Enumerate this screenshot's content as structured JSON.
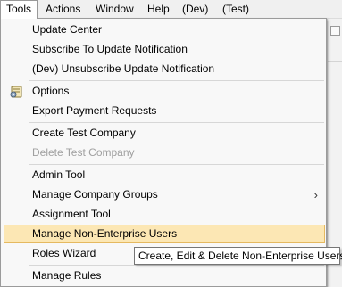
{
  "menubar": {
    "items": [
      {
        "label": "Tools"
      },
      {
        "label": "Actions"
      },
      {
        "label": "Window"
      },
      {
        "label": "Help"
      },
      {
        "label": "(Dev)"
      },
      {
        "label": "(Test)"
      }
    ]
  },
  "tools_menu": {
    "items": [
      {
        "label": "Update Center"
      },
      {
        "label": "Subscribe To Update Notification"
      },
      {
        "label": "(Dev) Unsubscribe Update Notification"
      },
      {
        "label": "Options",
        "icon": "options-icon"
      },
      {
        "label": "Export Payment Requests"
      },
      {
        "label": "Create Test Company"
      },
      {
        "label": "Delete Test Company",
        "disabled": true
      },
      {
        "label": "Admin Tool"
      },
      {
        "label": "Manage Company Groups",
        "submenu_indicator": "›"
      },
      {
        "label": "Assignment Tool"
      },
      {
        "label": "Manage Non-Enterprise Users",
        "highlighted": true
      },
      {
        "label": "Roles Wizard"
      },
      {
        "label": "Manage Rules"
      }
    ]
  },
  "tooltip": {
    "text": "Create, Edit & Delete Non-Enterprise Users"
  },
  "colors": {
    "highlight_bg": "#fce7b4",
    "highlight_border": "#e5b960",
    "disabled_text": "#a0a0a0"
  }
}
